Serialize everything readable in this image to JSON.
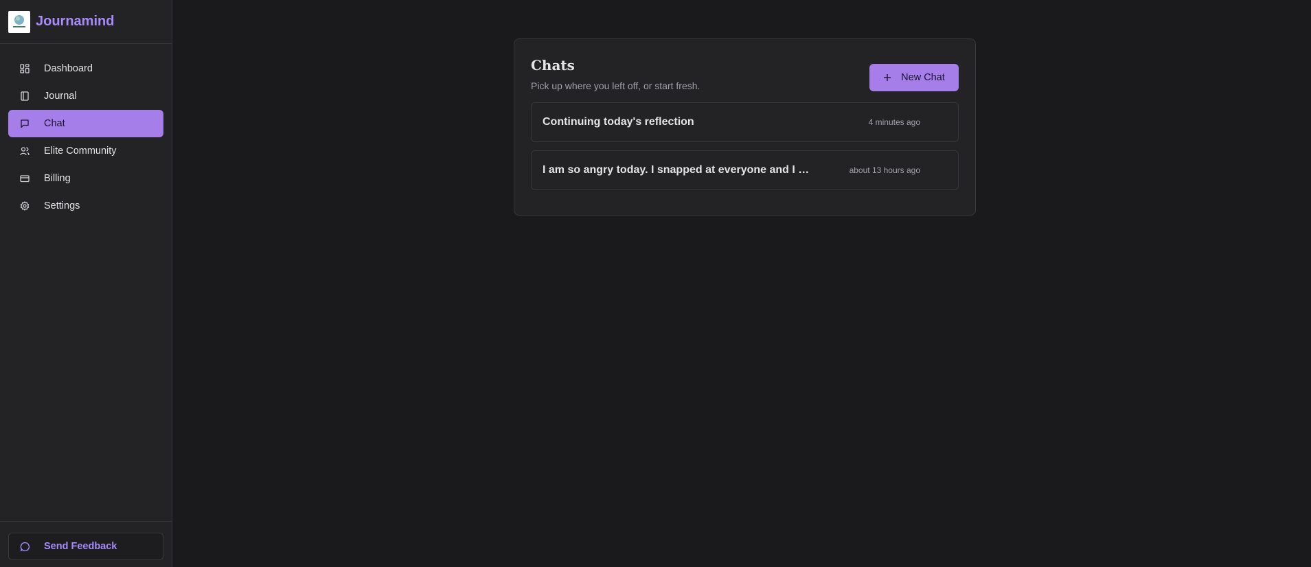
{
  "brand": {
    "name": "Journamind"
  },
  "sidebar": {
    "items": [
      {
        "label": "Dashboard",
        "icon": "dashboard-icon",
        "active": false
      },
      {
        "label": "Journal",
        "icon": "notebook-icon",
        "active": false
      },
      {
        "label": "Chat",
        "icon": "chat-bubble-icon",
        "active": true
      },
      {
        "label": "Elite Community",
        "icon": "users-icon",
        "active": false
      },
      {
        "label": "Billing",
        "icon": "credit-card-icon",
        "active": false
      },
      {
        "label": "Settings",
        "icon": "gear-icon",
        "active": false
      }
    ],
    "feedback_label": "Send Feedback"
  },
  "main": {
    "title": "Chats",
    "subtitle": "Pick up where you left off, or start fresh.",
    "new_chat_label": "New Chat",
    "chats": [
      {
        "title": "Continuing today's reflection",
        "time": "4 minutes ago"
      },
      {
        "title": "I am so angry today. I snapped at everyone and I don't know why",
        "time": "about 13 hours ago"
      }
    ]
  },
  "colors": {
    "accent": "#a57ee9",
    "brand": "#a78bfa",
    "background": "#1a1a1c",
    "panel": "#232326",
    "border": "#38383c"
  }
}
